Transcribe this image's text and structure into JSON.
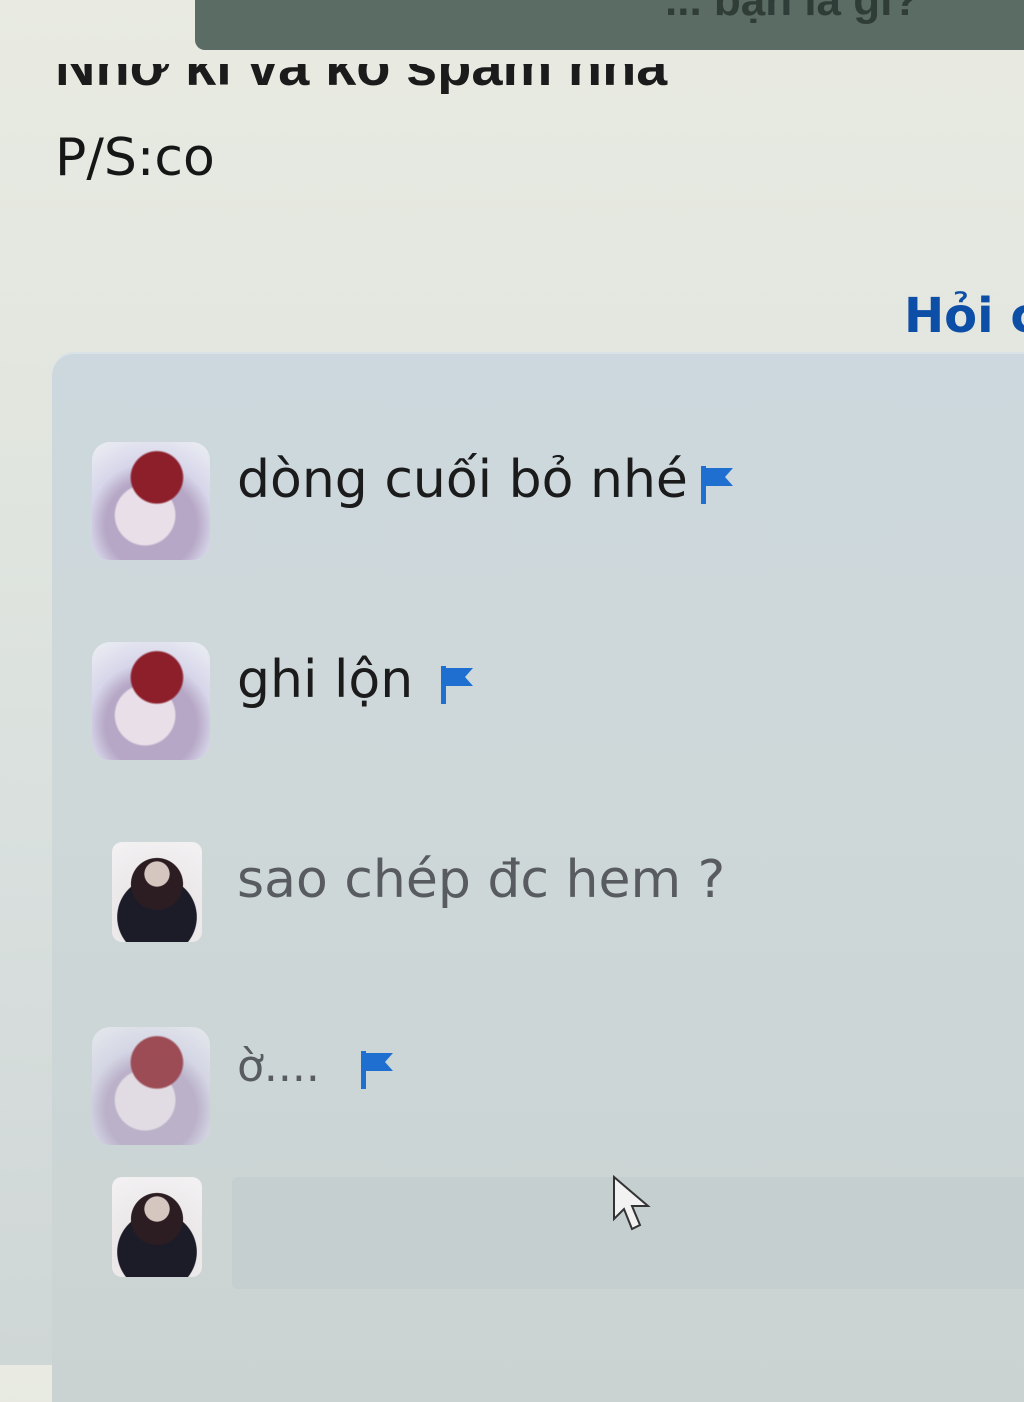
{
  "header": {
    "title": "... bạn là gì?"
  },
  "post": {
    "partial_line": "Nhớ kĩ và ko spam nha",
    "ps_line": "P/S:co"
  },
  "ask_link": "Hỏi ch",
  "comments": [
    {
      "text": "dòng cuối bỏ nhé",
      "avatar": "boy-avatar",
      "flag": true
    },
    {
      "text": "ghi lộn",
      "avatar": "boy-avatar",
      "flag": true
    },
    {
      "text": "sao chép đc hem ?",
      "avatar": "girl-avatar",
      "flag": false
    },
    {
      "text": "ờ....",
      "avatar": "boy-avatar",
      "flag": true
    }
  ],
  "reply": {
    "placeholder": ""
  },
  "colors": {
    "accent": "#0d4ea6",
    "flag": "#1f6fd1"
  }
}
